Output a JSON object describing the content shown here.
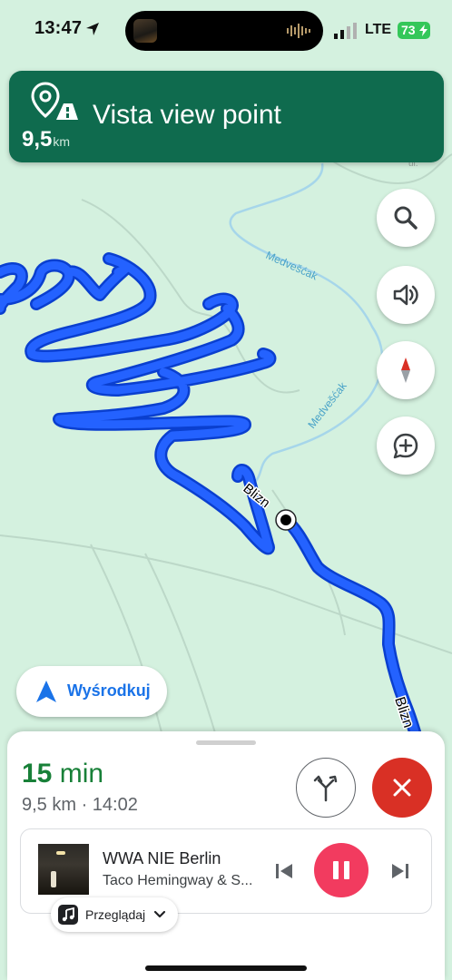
{
  "status_bar": {
    "time": "13:47",
    "network": "LTE",
    "battery": "73"
  },
  "navigation": {
    "destination": "Vista view point",
    "distance_value": "9,5",
    "distance_unit": "km",
    "icon": "location-pin-with-road-icon"
  },
  "map": {
    "street_label_1": "Blizn",
    "street_label_2": "Blizn",
    "river_label_1": "Medvešćak",
    "river_label_2": "Medvešćak",
    "corner_label": "ul."
  },
  "map_controls": {
    "search": "search-icon",
    "sound": "volume-icon",
    "compass": "compass-icon",
    "report": "add-report-icon",
    "recenter_label": "Wyśrodkuj"
  },
  "trip": {
    "eta_value": "15",
    "eta_unit": "min",
    "details": "9,5 km · 14:02"
  },
  "media": {
    "title": "WWA NIE Berlin",
    "artist": "Taco Hemingway & S...",
    "browse_label": "Przeglądaj",
    "state": "playing"
  },
  "colors": {
    "map_background": "#d4f1df",
    "route": "#1a5cff",
    "banner": "#0f6b4e",
    "eta": "#188038",
    "exit": "#d93025",
    "play": "#f23b5f"
  }
}
